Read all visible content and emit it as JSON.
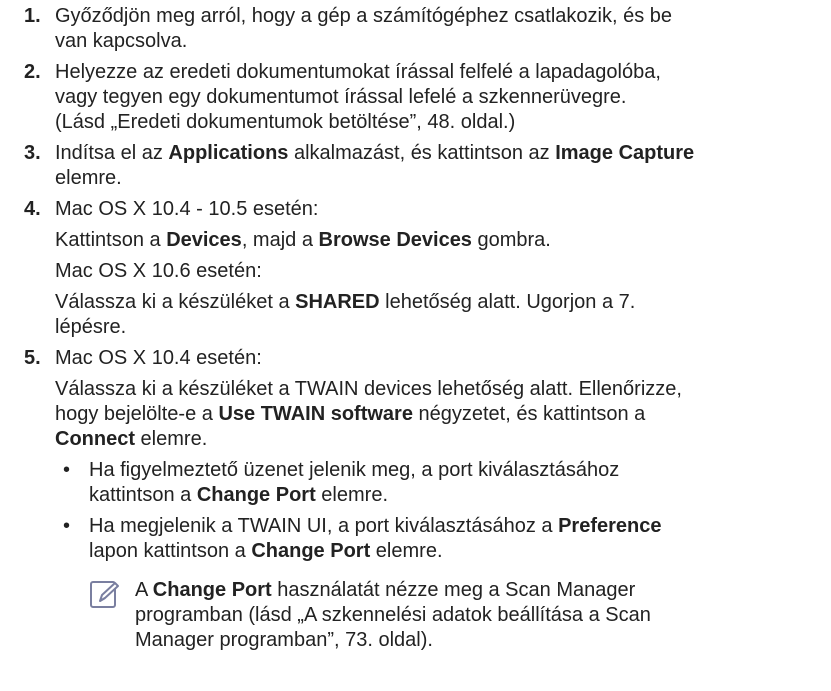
{
  "steps": [
    {
      "num": "1.",
      "lines": [
        "Győződjön meg arról, hogy a gép a számítógéphez csatlakozik, és be",
        "van kapcsolva."
      ]
    },
    {
      "num": "2.",
      "lines": [
        "Helyezze az eredeti dokumentumokat írással felfelé a lapadagolóba,",
        "vagy tegyen egy dokumentumot írással lefelé a szkennerüvegre.",
        "(Lásd „Eredeti dokumentumok betöltése”, 48. oldal.)"
      ]
    },
    {
      "num": "3.",
      "l1_a": "Indítsa el az ",
      "l1_b": "Applications",
      "l1_c": " alkalmazást, és kattintson az ",
      "l1_d": "Image Capture",
      "l2": "elemre."
    },
    {
      "num": "4.",
      "p1": "Mac OS X 10.4 - 10.5 esetén:",
      "p2_a": "Kattintson a ",
      "p2_b": "Devices",
      "p2_c": ", majd a ",
      "p2_d": "Browse Devices",
      "p2_e": " gombra.",
      "p3": "Mac OS X 10.6 esetén:",
      "p4_a": "Válassza ki a készüléket a ",
      "p4_b": "SHARED",
      "p4_c": " lehetőség alatt. Ugorjon a 7.",
      "p4_l2": "lépésre."
    },
    {
      "num": "5.",
      "p1": "Mac OS X 10.4 esetén:",
      "p2_l1": "Válassza ki a készüléket a TWAIN devices lehetőség alatt. Ellenőrizze,",
      "p2_l2_a": "hogy bejelölte-e a ",
      "p2_l2_b": "Use TWAIN software",
      "p2_l2_c": " négyzetet, és kattintson a",
      "p2_l3_a": "Connect",
      "p2_l3_b": " elemre.",
      "bullets": [
        {
          "mark": "•",
          "l1": "Ha figyelmeztető üzenet jelenik meg, a port kiválasztásához",
          "l2_a": "kattintson a ",
          "l2_b": "Change Port",
          "l2_c": " elemre."
        },
        {
          "mark": "•",
          "l1_a": "Ha megjelenik a TWAIN UI, a port kiválasztásához a ",
          "l1_b": "Preference",
          "l2_a": "lapon kattintson a ",
          "l2_b": "Change Port",
          "l2_c": " elemre."
        }
      ],
      "note": {
        "icon": "note-pencil-icon",
        "l1_a": "A ",
        "l1_b": "Change Port",
        "l1_c": " használatát nézze meg a Scan Manager",
        "l2": "programban (lásd „A szkennelési adatok beállítása a Scan",
        "l3": "Manager programban”, 73. oldal)."
      }
    }
  ],
  "colors": {
    "text": "#222222",
    "icon_stroke": "#7a7fa0"
  }
}
